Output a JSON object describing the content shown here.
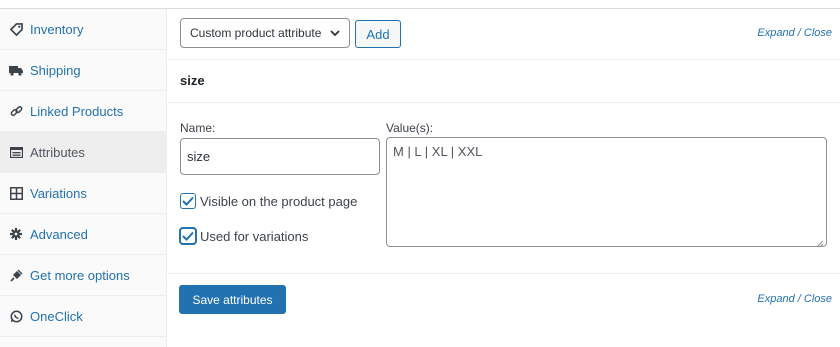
{
  "sidebar": {
    "items": [
      {
        "label": "Inventory",
        "icon": "tag-icon",
        "active": false
      },
      {
        "label": "Shipping",
        "icon": "truck-icon",
        "active": false
      },
      {
        "label": "Linked Products",
        "icon": "link-icon",
        "active": false
      },
      {
        "label": "Attributes",
        "icon": "list-card-icon",
        "active": true
      },
      {
        "label": "Variations",
        "icon": "grid-icon",
        "active": false
      },
      {
        "label": "Advanced",
        "icon": "gear-icon",
        "active": false
      },
      {
        "label": "Get more options",
        "icon": "plugin-icon",
        "active": false
      },
      {
        "label": "OneClick",
        "icon": "whatsapp-icon",
        "active": false
      }
    ]
  },
  "toolbar": {
    "select_value": "Custom product attribute",
    "add_label": "Add",
    "expand_label": "Expand",
    "separator": "/",
    "close_label": "Close"
  },
  "attribute": {
    "title": "size",
    "name_label": "Name:",
    "name_value": "size",
    "values_label": "Value(s):",
    "values_value": "M | L | XL | XXL",
    "visible_label": "Visible on the product page",
    "visible_checked": true,
    "variations_label": "Used for variations",
    "variations_checked": true
  },
  "footer": {
    "save_label": "Save attributes",
    "expand_label": "Expand",
    "separator": "/",
    "close_label": "Close"
  },
  "colors": {
    "link": "#2271b1",
    "primary_button": "#2271b1",
    "active_tab_bg": "#eeeeee"
  }
}
